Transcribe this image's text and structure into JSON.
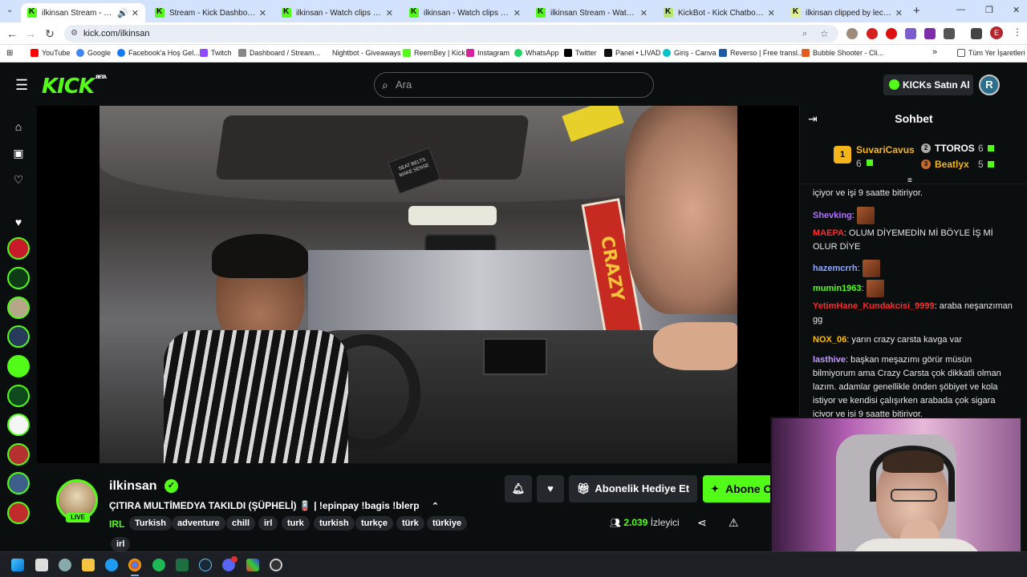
{
  "browser": {
    "tabs": [
      {
        "title": "ilkinsan Stream - Watch Live on",
        "active": true,
        "audio": true
      },
      {
        "title": "Stream - Kick Dashboard"
      },
      {
        "title": "ilkinsan - Watch clips on Kick"
      },
      {
        "title": "ilkinsan - Watch clips on Kick"
      },
      {
        "title": "ilkinsan Stream - Watch Live on"
      },
      {
        "title": "KickBot - Kick Chatbot, Alerts,"
      },
      {
        "title": "ilkinsan clipped by leclercurry"
      }
    ],
    "new_tab": "+",
    "url": "kick.com/ilkinsan",
    "profile_initial": "E",
    "bookmarks": [
      "YouTube",
      "Google",
      "Facebook'a Hoş Gel...",
      "Twitch",
      "Dashboard / Stream...",
      "Nightbot - Giveaways",
      "ReemBey | Kick",
      "Instagram",
      "WhatsApp",
      "Twitter",
      "Panel • LIVAD",
      "Giriş - Canva",
      "Reverso | Free transl...",
      "Bubble Shooter - Cli..."
    ],
    "all_bookmarks": "Tüm Yer İşaretleri",
    "more_bookmarks": "»"
  },
  "header": {
    "logo": "KICK",
    "logo_badge": "BETA",
    "search_placeholder": "Ara",
    "buy_kicks": "KICKs Satın Al",
    "user_initial": "R"
  },
  "stream": {
    "channel": "ilkinsan",
    "live_label": "LIVE",
    "title": "ÇITIRA MULTİMEDYA TAKILDI (ŞÜPHELİ) 🪫 | !epinpay !bagis !blerp",
    "category": "IRL",
    "tags": [
      "Turkish",
      "adventure",
      "chill",
      "irl",
      "turk",
      "turkish",
      "turkçe",
      "türk",
      "türkiye",
      "irl"
    ],
    "gift_sub": "Abonelik Hediye Et",
    "subscribe": "Abone Ol",
    "viewer_count": "2.039",
    "viewer_label": "İzleyici",
    "video_sign": "CRAZY",
    "video_notice": "SEAT BELTS MAKE SENSE"
  },
  "chat": {
    "title": "Sohbet",
    "leaderboard": [
      {
        "rank": "1",
        "name": "SuvariCavus",
        "count": "6"
      },
      {
        "rank": "2",
        "name": "TTOROS",
        "count": "6"
      },
      {
        "rank": "3",
        "name": "Beatlyx",
        "count": "5"
      }
    ],
    "messages": [
      {
        "user": "",
        "text": "içiyor ve işi 9 saatte bitiriyor.",
        "color": "#e8e8e8"
      },
      {
        "user": "Shevking",
        "text": "",
        "emote": true,
        "color": "#b072ff"
      },
      {
        "user": "MAEPA",
        "text": "OLUM DİYEMEDİN Mİ BÖYLE İŞ Mİ OLUR DİYE",
        "color": "#ff2a2a"
      },
      {
        "user": "hazemcrrh",
        "text": "",
        "emote": true,
        "color": "#8fa8ff"
      },
      {
        "user": "mumin1963",
        "text": "",
        "emote": true,
        "color": "#53fc18"
      },
      {
        "user": "YetimHane_Kundakcisi_9999",
        "text": "araba neşanzıman gg",
        "color": "#ff2a2a"
      },
      {
        "user": "NOX_06",
        "text": "yarın crazy carsta kavga var",
        "color": "#ffbf00"
      },
      {
        "user": "lasthive",
        "text": "başkan meşazımı görür müsün bilmiyorum ama Crazy Carsta çok dikkatli olman lazım. adamlar genellikle önden şöbiyet ve kola istiyor ve kendisi çalışırken arabada çok sigara içiyor ve işi 9 saatte bitiriyor.",
        "color": "#c49bff"
      }
    ]
  },
  "colors": {
    "accent": "#53fc18",
    "bg": "#0b0e0f",
    "panel": "#24272c"
  }
}
